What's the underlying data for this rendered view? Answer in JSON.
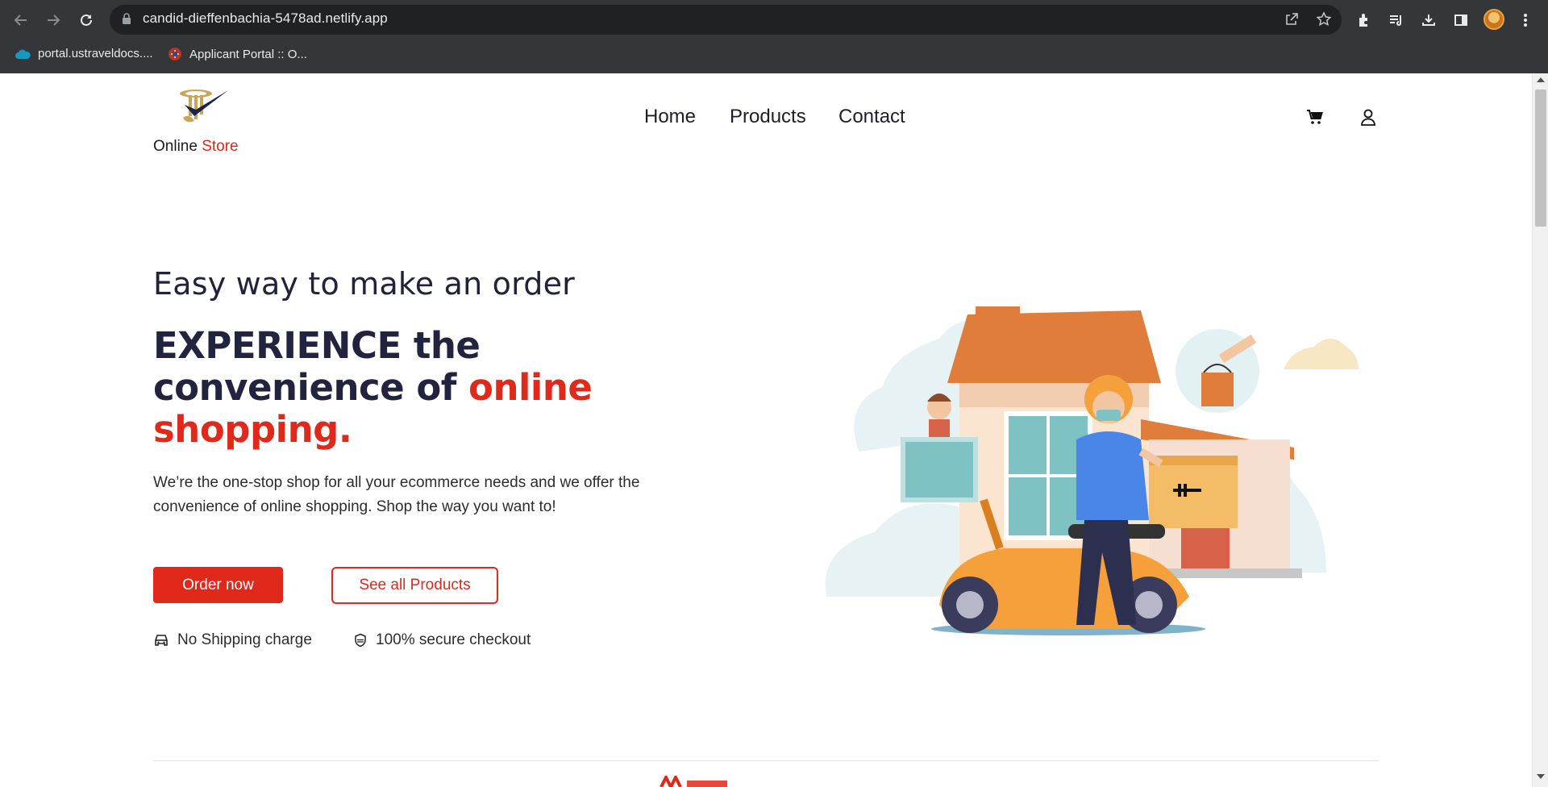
{
  "browser": {
    "url": "candid-dieffenbachia-5478ad.netlify.app",
    "bookmarks": [
      {
        "label": "portal.ustraveldocs...."
      },
      {
        "label": "Applicant Portal :: O..."
      }
    ]
  },
  "header": {
    "logo": {
      "text_main": "Online ",
      "text_accent": "Store"
    },
    "nav": [
      {
        "label": "Home"
      },
      {
        "label": "Products"
      },
      {
        "label": "Contact"
      }
    ]
  },
  "hero": {
    "eyebrow": "Easy way to make an order",
    "headline_part1": "EXPERIENCE the convenience of ",
    "headline_part2": "online shopping.",
    "description": "We’re the one-stop shop for all your ecommerce needs and we offer the convenience of online shopping. Shop the way you want to!",
    "primary_button": "Order now",
    "secondary_button": "See all Products",
    "features": [
      {
        "icon": "car-icon",
        "label": "No Shipping charge"
      },
      {
        "icon": "shield-check-icon",
        "label": "100% secure checkout"
      }
    ]
  },
  "colors": {
    "accent": "#e0291a",
    "heading": "#22233f",
    "chrome_bg": "#35363a",
    "omnibox_bg": "#202124"
  }
}
